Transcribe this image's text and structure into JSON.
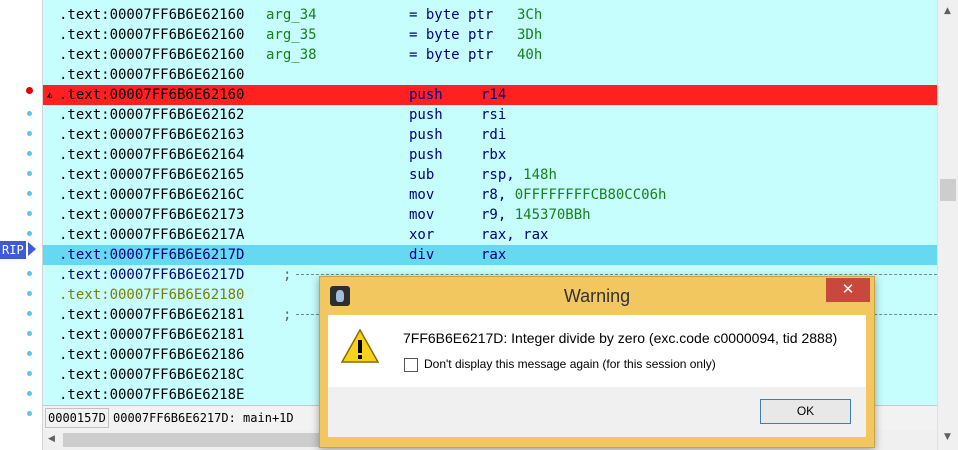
{
  "gutter": {
    "rip_label": "RIP"
  },
  "listing": {
    "rows": [
      {
        "addr": ".text:00007FF6B6E62160",
        "label": "arg_34",
        "mn": "= byte ptr",
        "op": "3Ch"
      },
      {
        "addr": ".text:00007FF6B6E62160",
        "label": "arg_35",
        "mn": "= byte ptr",
        "op": "3Dh"
      },
      {
        "addr": ".text:00007FF6B6E62160",
        "label": "arg_38",
        "mn": "= byte ptr",
        "op": "40h"
      },
      {
        "addr": ".text:00007FF6B6E62160",
        "label": "",
        "mn": "",
        "op": ""
      },
      {
        "addr": ".text:00007FF6B6E62160",
        "label": "",
        "mn": "push",
        "op": "r14"
      },
      {
        "addr": ".text:00007FF6B6E62162",
        "label": "",
        "mn": "push",
        "op": "rsi"
      },
      {
        "addr": ".text:00007FF6B6E62163",
        "label": "",
        "mn": "push",
        "op": "rdi"
      },
      {
        "addr": ".text:00007FF6B6E62164",
        "label": "",
        "mn": "push",
        "op": "rbx"
      },
      {
        "addr": ".text:00007FF6B6E62165",
        "label": "",
        "mn": "sub",
        "op": "rsp,",
        "num": "148h"
      },
      {
        "addr": ".text:00007FF6B6E6216C",
        "label": "",
        "mn": "mov",
        "op": "r8,",
        "num": "0FFFFFFFFCB80CC06h"
      },
      {
        "addr": ".text:00007FF6B6E62173",
        "label": "",
        "mn": "mov",
        "op": "r9,",
        "num": "145370BBh"
      },
      {
        "addr": ".text:00007FF6B6E6217A",
        "label": "",
        "mn": "xor",
        "op": "rax, rax"
      },
      {
        "addr": ".text:00007FF6B6E6217D",
        "label": "",
        "mn": "div",
        "op": "rax"
      },
      {
        "addr": ".text:00007FF6B6E6217D",
        "label": "",
        "mn": "",
        "op": "",
        "cmt": ";"
      },
      {
        "addr": ".text:00007FF6B6E62180",
        "label": "",
        "mn": "",
        "op": ""
      },
      {
        "addr": ".text:00007FF6B6E62181",
        "label": "",
        "mn": "",
        "op": "",
        "cmt": ";"
      },
      {
        "addr": ".text:00007FF6B6E62181",
        "label": "",
        "mn": "",
        "op": ""
      },
      {
        "addr": ".text:00007FF6B6E62186",
        "label": "",
        "mn": "",
        "op": ""
      },
      {
        "addr": ".text:00007FF6B6E6218C",
        "label": "",
        "mn": "",
        "op": ""
      },
      {
        "addr": ".text:00007FF6B6E6218E",
        "label": "",
        "mn": "",
        "op": ""
      }
    ]
  },
  "status": {
    "offset": "0000157D",
    "location": "00007FF6B6E6217D: main+1D"
  },
  "dialog": {
    "title": "Warning",
    "close_label": "✕",
    "message": "7FF6B6E6217D: Integer divide by zero (exc.code c0000094, tid 2888)",
    "checkbox_label": "Don't display this message again (for this session only)",
    "ok_label": "OK"
  },
  "colors": {
    "listing_bg": "#c6fdfd",
    "breakpoint_row": "#ff2020",
    "current_row": "#66d8f0",
    "rip_badge": "#3e5bd6",
    "dialog_frame": "#f2c760",
    "close_button": "#c9483c"
  },
  "icons": [
    "breakpoint-dot",
    "execution-dot",
    "rip-arrow-icon",
    "app-icon",
    "warning-icon",
    "close-icon"
  ]
}
